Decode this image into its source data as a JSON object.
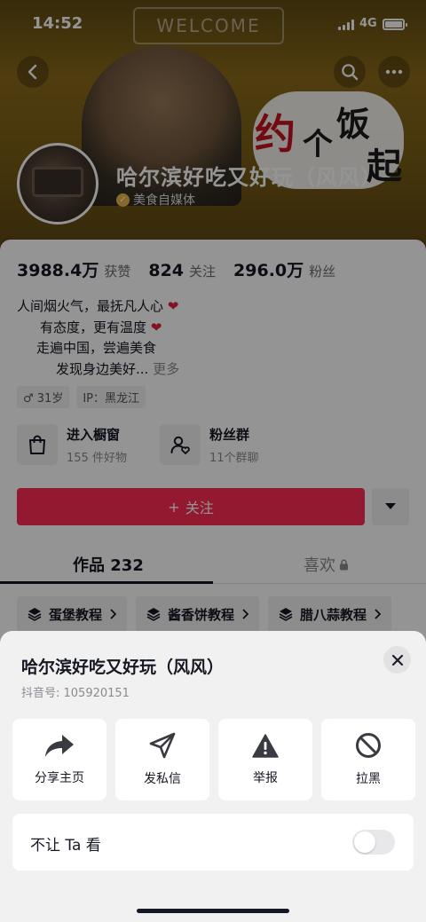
{
  "status_bar": {
    "time": "14:52",
    "network": "4G"
  },
  "banner": {
    "welcome_text": "WELCOME",
    "art_main": "约个饭起"
  },
  "profile": {
    "name": "哈尔滨好吃又好玩（风风）",
    "verify_text": "美食自媒体"
  },
  "stats": [
    {
      "value": "3988.4万",
      "label": "获赞"
    },
    {
      "value": "824",
      "label": "关注"
    },
    {
      "value": "296.0万",
      "label": "粉丝"
    }
  ],
  "bio": {
    "line1": "人间烟火气，最抚凡人心",
    "line2": "有态度，更有温度",
    "line3": "走遍中国，尝遍美食",
    "line4": "发现身边美好...",
    "more": "更多",
    "heart": "❤"
  },
  "tags": {
    "age": "♂ 31岁",
    "ip": "IP：黑龙江"
  },
  "entries": {
    "shop_title": "进入橱窗",
    "shop_sub": "155 件好物",
    "group_title": "粉丝群",
    "group_sub": "11个群聊"
  },
  "follow": {
    "label": "关注",
    "plus": "+"
  },
  "tabs": {
    "works": "作品 232",
    "likes": "喜欢"
  },
  "collections": [
    "蛋堡教程",
    "酱香饼教程",
    "腊八蒜教程"
  ],
  "sheet": {
    "title": "哈尔滨好吃又好玩（风风）",
    "douyin_id": "抖音号: 105920151",
    "actions": [
      "分享主页",
      "发私信",
      "举报",
      "拉黑"
    ],
    "toggle_label": "不让 Ta 看",
    "toggle_on": false
  },
  "colors": {
    "accent": "#fe2c55",
    "text": "#161823",
    "muted": "#8a8b91"
  }
}
